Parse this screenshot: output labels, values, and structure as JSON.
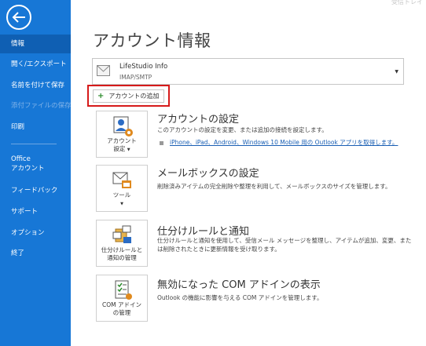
{
  "top_right_text": "受信トレイ",
  "sidebar": {
    "items": [
      {
        "label": "情報"
      },
      {
        "label": "開く/エクスポート"
      },
      {
        "label": "名前を付けて保存"
      },
      {
        "label": "添付ファイルの保存"
      },
      {
        "label": "印刷"
      },
      {
        "label": "Office"
      },
      {
        "label": "アカウント"
      },
      {
        "label": "フィードバック"
      },
      {
        "label": "サポート"
      },
      {
        "label": "オプション"
      },
      {
        "label": "終了"
      }
    ]
  },
  "main": {
    "title": "アカウント情報",
    "account": {
      "name": "LifeStudio Info",
      "type": "IMAP/SMTP"
    },
    "add_account_label": "アカウントの追加",
    "sections": [
      {
        "tile_label_1": "アカウント",
        "tile_label_2": "設定",
        "title": "アカウントの設定",
        "desc": "このアカウントの設定を変更、または追加の接続を設定します。",
        "link": "iPhone、iPad、Android、Windows 10 Mobile 用の Outlook アプリを取得します。"
      },
      {
        "tile_label_1": "ツール",
        "title": "メールボックスの設定",
        "desc": "削除済みアイテムの完全削除や整理を利用して、メールボックスのサイズを管理します。"
      },
      {
        "tile_label_1": "仕分けルールと",
        "tile_label_2": "通知の管理",
        "title": "仕分けルールと通知",
        "desc_1": "仕分けルールと通知を使用して、受信メール メッセージを整理し、アイテムが追加、変更、また",
        "desc_2": "は削除されたときに更新情報を受け取ります。"
      },
      {
        "tile_label_1": "COM アドイン",
        "tile_label_2": "の管理",
        "title": "無効になった COM アドインの表示",
        "desc": "Outlook の機能に影響を与える COM アドインを管理します。"
      }
    ]
  },
  "colors": {
    "sidebar": "#1777d6",
    "sidebar_active": "#0f5fb3",
    "highlight_border": "#d61a1a",
    "link": "#1a5fb4"
  }
}
